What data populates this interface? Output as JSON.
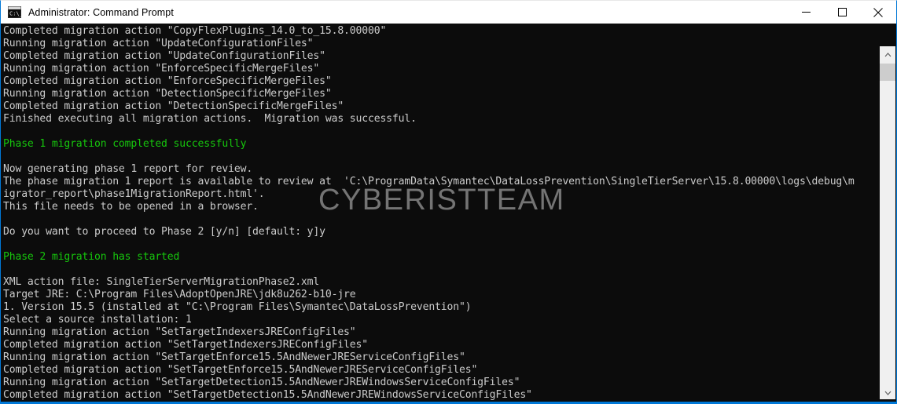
{
  "window": {
    "title": "Administrator: Command Prompt",
    "app_icon": "console-icon",
    "controls": {
      "minimize": "minimize-button",
      "maximize": "maximize-button",
      "close": "close-button"
    },
    "border_color": "#0078d7"
  },
  "watermark": {
    "text": "CYBERISTTEAM",
    "color": "#7d7d7d"
  },
  "console": {
    "background": "#0c0c0c",
    "foreground": "#cccccc",
    "success_color": "#16c60c",
    "lines": [
      {
        "text": "Completed migration action \"CopyFlexPlugins_14.0_to_15.8.00000\"",
        "color": "default"
      },
      {
        "text": "Running migration action \"UpdateConfigurationFiles\"",
        "color": "default"
      },
      {
        "text": "Completed migration action \"UpdateConfigurationFiles\"",
        "color": "default"
      },
      {
        "text": "Running migration action \"EnforceSpecificMergeFiles\"",
        "color": "default"
      },
      {
        "text": "Completed migration action \"EnforceSpecificMergeFiles\"",
        "color": "default"
      },
      {
        "text": "Running migration action \"DetectionSpecificMergeFiles\"",
        "color": "default"
      },
      {
        "text": "Completed migration action \"DetectionSpecificMergeFiles\"",
        "color": "default"
      },
      {
        "text": "Finished executing all migration actions.  Migration was successful.",
        "color": "default"
      },
      {
        "text": "",
        "color": "default"
      },
      {
        "text": "Phase 1 migration completed successfully",
        "color": "green"
      },
      {
        "text": "",
        "color": "default"
      },
      {
        "text": "Now generating phase 1 report for review.",
        "color": "default"
      },
      {
        "text": "The phase migration 1 report is available to review at  'C:\\ProgramData\\Symantec\\DataLossPrevention\\SingleTierServer\\15.8.00000\\logs\\debug\\m",
        "color": "default"
      },
      {
        "text": "igrator_report\\phase1MigrationReport.html'.",
        "color": "default"
      },
      {
        "text": "This file needs to be opened in a browser.",
        "color": "default"
      },
      {
        "text": "",
        "color": "default"
      },
      {
        "text": "Do you want to proceed to Phase 2 [y/n] [default: y]y",
        "color": "default"
      },
      {
        "text": "",
        "color": "default"
      },
      {
        "text": "Phase 2 migration has started",
        "color": "green"
      },
      {
        "text": "",
        "color": "default"
      },
      {
        "text": "XML action file: SingleTierServerMigrationPhase2.xml",
        "color": "default"
      },
      {
        "text": "Target JRE: C:\\Program Files\\AdoptOpenJRE\\jdk8u262-b10-jre",
        "color": "default"
      },
      {
        "text": "1. Version 15.5 (installed at \"C:\\Program Files\\Symantec\\DataLossPrevention\")",
        "color": "default"
      },
      {
        "text": "Select a source installation: 1",
        "color": "default"
      },
      {
        "text": "Running migration action \"SetTargetIndexersJREConfigFiles\"",
        "color": "default"
      },
      {
        "text": "Completed migration action \"SetTargetIndexersJREConfigFiles\"",
        "color": "default"
      },
      {
        "text": "Running migration action \"SetTargetEnforce15.5AndNewerJREServiceConfigFiles\"",
        "color": "default"
      },
      {
        "text": "Completed migration action \"SetTargetEnforce15.5AndNewerJREServiceConfigFiles\"",
        "color": "default"
      },
      {
        "text": "Running migration action \"SetTargetDetection15.5AndNewerJREWindowsServiceConfigFiles\"",
        "color": "default"
      },
      {
        "text": "Completed migration action \"SetTargetDetection15.5AndNewerJREWindowsServiceConfigFiles\"",
        "color": "default"
      }
    ]
  },
  "scrollbar": {
    "up_arrow": "scroll-up-icon",
    "down_arrow": "scroll-down-icon",
    "thumb": "scrollbar-thumb"
  }
}
